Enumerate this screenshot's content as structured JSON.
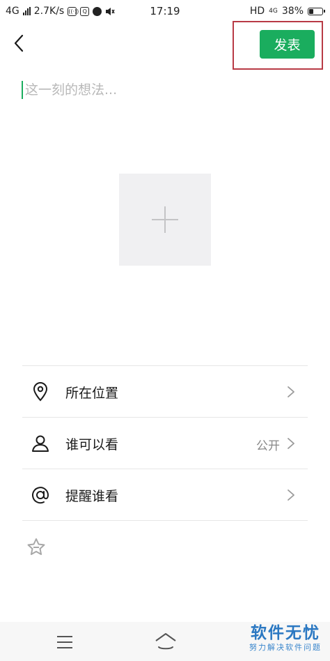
{
  "status_bar": {
    "network": "4G",
    "speed": "2.7K/s",
    "time": "17:19",
    "hd_label": "HD",
    "network_right": "4G",
    "battery": "38%",
    "battery_level": 0.38
  },
  "header": {
    "back_icon": "chevron-left-icon",
    "publish_label": "发表"
  },
  "composer": {
    "placeholder": "这一刻的想法...",
    "value": ""
  },
  "add_photo": {
    "icon": "plus-icon"
  },
  "options": [
    {
      "icon": "location-pin-icon",
      "label": "所在位置",
      "value": ""
    },
    {
      "icon": "person-icon",
      "label": "谁可以看",
      "value": "公开"
    },
    {
      "icon": "at-icon",
      "label": "提醒谁看",
      "value": ""
    }
  ],
  "extra": {
    "star_icon": "star-icon"
  },
  "nav": {
    "menu_icon": "menu-icon",
    "home_icon": "home-icon"
  },
  "watermark": {
    "title": "软件无忧",
    "subtitle": "努力解决软件问题"
  },
  "colors": {
    "accent": "#1aad5e",
    "highlight": "#b83a45",
    "watermark": "#2b78c2"
  }
}
